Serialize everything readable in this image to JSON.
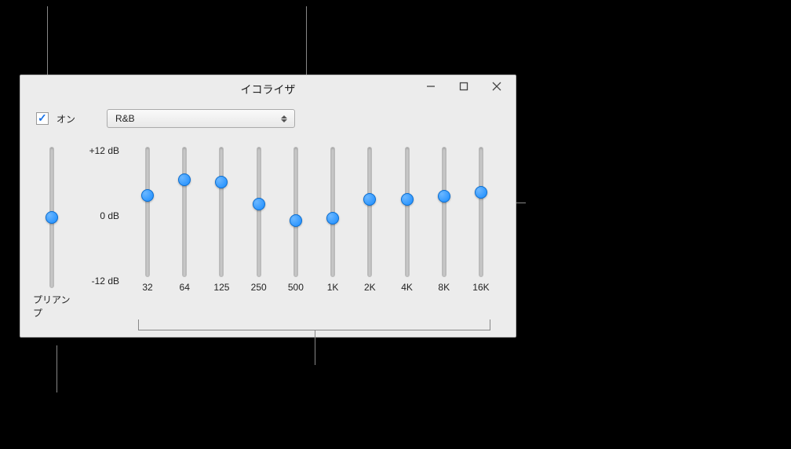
{
  "window": {
    "title": "イコライザ",
    "on_label": "オン",
    "on_checked": true,
    "preset": "R&B",
    "preamp_label": "プリアンプ",
    "preamp_value_pct": 50
  },
  "scale": {
    "max": "+12 dB",
    "mid": "0 dB",
    "min": "-12 dB"
  },
  "bands": [
    {
      "freq": "32",
      "value_pct": 37
    },
    {
      "freq": "64",
      "value_pct": 25
    },
    {
      "freq": "125",
      "value_pct": 27
    },
    {
      "freq": "250",
      "value_pct": 44
    },
    {
      "freq": "500",
      "value_pct": 57
    },
    {
      "freq": "1K",
      "value_pct": 55
    },
    {
      "freq": "2K",
      "value_pct": 40
    },
    {
      "freq": "4K",
      "value_pct": 40
    },
    {
      "freq": "8K",
      "value_pct": 38
    },
    {
      "freq": "16K",
      "value_pct": 35
    }
  ]
}
